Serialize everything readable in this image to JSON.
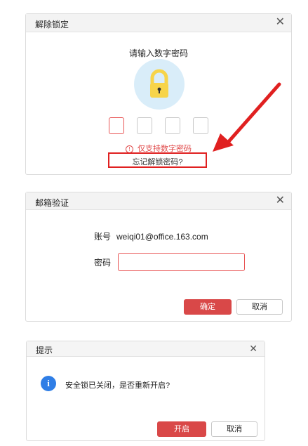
{
  "unlock_dialog": {
    "title": "解除锁定",
    "close_glyph": "✕",
    "prompt": "请输入数字密码",
    "lock_icon": "padlock-icon",
    "digit_count": 4,
    "error_icon_glyph": "!",
    "error_text": "仅支持数字密码",
    "forgot_link": "忘记解锁密码?"
  },
  "email_dialog": {
    "title": "邮箱验证",
    "close_glyph": "✕",
    "account_label": "账号",
    "account_value": "weiqi01@office.163.com",
    "password_label": "密码",
    "password_value": "",
    "confirm_button": "确定",
    "cancel_button": "取消"
  },
  "prompt_dialog": {
    "title": "提示",
    "close_glyph": "✕",
    "info_icon_glyph": "i",
    "message": "安全锁已关闭，是否重新开启?",
    "enable_button": "开启",
    "cancel_button": "取消"
  },
  "colors": {
    "accent_red": "#d94848",
    "info_blue": "#2f7ee6",
    "lock_bg": "#d9edf9",
    "lock_body": "#f7d449",
    "annotation_red": "#e02020"
  }
}
